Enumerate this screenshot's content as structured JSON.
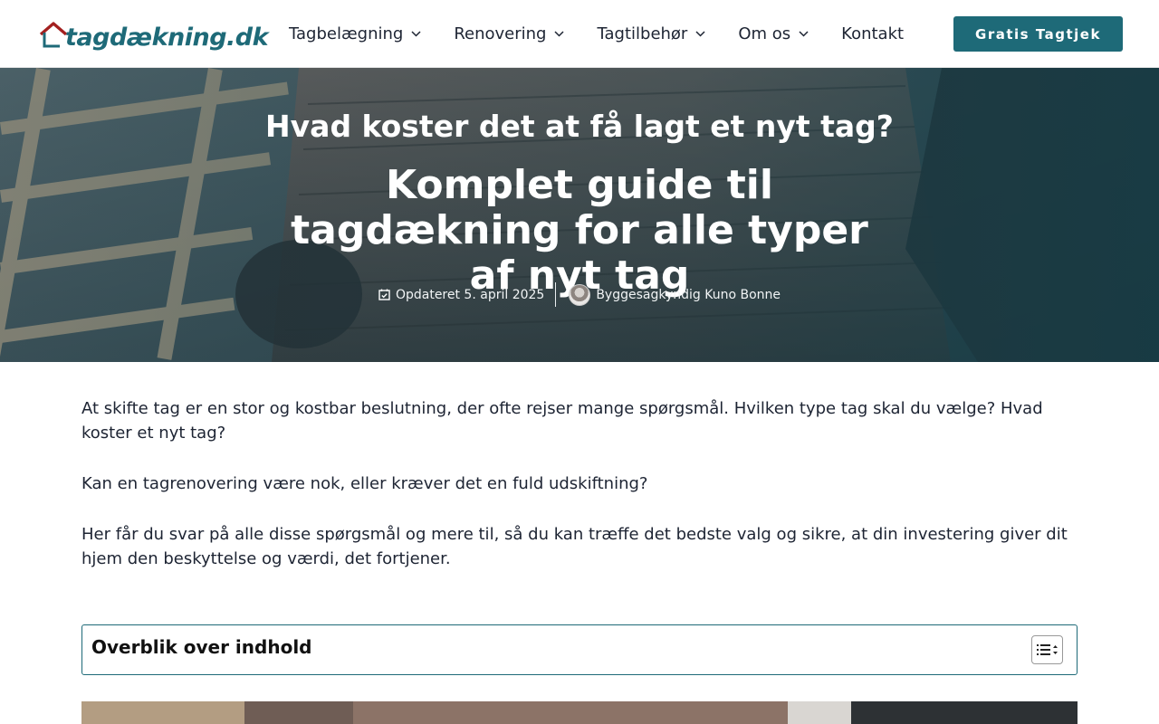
{
  "header": {
    "logo_text": "tagdækning.dk",
    "nav": [
      {
        "label": "Tagbelægning",
        "has_dropdown": true
      },
      {
        "label": "Renovering",
        "has_dropdown": true
      },
      {
        "label": "Tagtilbehør",
        "has_dropdown": true
      },
      {
        "label": "Om os",
        "has_dropdown": true
      },
      {
        "label": "Kontakt",
        "has_dropdown": false
      }
    ],
    "cta_label": "Gratis Tagtjek"
  },
  "hero": {
    "subtitle": "Hvad koster det at få lagt et nyt tag?",
    "title": "Komplet guide til tagdækning for alle typer af nyt tag",
    "updated": "Opdateret 5. april 2025",
    "author": "Byggesagkyndig Kuno Bonne"
  },
  "content": {
    "paragraphs": [
      "At skifte tag er en stor og kostbar beslutning, der ofte rejser mange spørgsmål. Hvilken type tag skal du vælge? Hvad koster et nyt tag?",
      "Kan en tagrenovering være nok, eller kræver det en fuld udskiftning?",
      "Her får du svar på alle disse spørgsmål og mere til, så du kan træffe det bedste valg og sikre, at din investering giver dit hjem den beskyttelse og værdi, det fortjener."
    ]
  },
  "toc": {
    "title": "Overblik over indhold"
  },
  "colors": {
    "brand": "#1e6a78",
    "logo_roof": "#a3201f",
    "text": "#1d2433"
  }
}
